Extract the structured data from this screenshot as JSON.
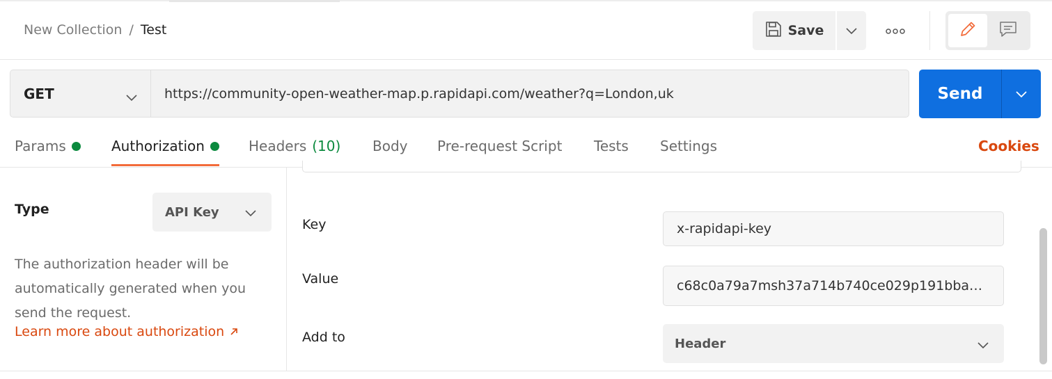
{
  "breadcrumb": {
    "collection": "New Collection",
    "separator": "/",
    "request": "Test"
  },
  "toolbar": {
    "save_label": "Save"
  },
  "request": {
    "method": "GET",
    "url": "https://community-open-weather-map.p.rapidapi.com/weather?q=London,uk",
    "send_label": "Send"
  },
  "tabs": [
    {
      "label": "Params",
      "has_dot": true
    },
    {
      "label": "Authorization",
      "has_dot": true,
      "active": true
    },
    {
      "label": "Headers",
      "count": "(10)"
    },
    {
      "label": "Body"
    },
    {
      "label": "Pre-request Script"
    },
    {
      "label": "Tests"
    },
    {
      "label": "Settings"
    }
  ],
  "cookies_label": "Cookies",
  "auth": {
    "type_label": "Type",
    "type_value": "API Key",
    "description": "The authorization header will be automatically generated when you send the request.",
    "learn_more": "Learn more about authorization",
    "key_label": "Key",
    "key_value": "x-rapidapi-key",
    "value_label": "Value",
    "value_value": "c68c0a79a7msh37a714b740ce029p191bba…",
    "add_to_label": "Add to",
    "add_to_value": "Header"
  },
  "colors": {
    "accent_blue": "#0f6fe0",
    "orange": "#d9480f",
    "green": "#0b8a3e",
    "tab_underline": "#f26b3a"
  }
}
